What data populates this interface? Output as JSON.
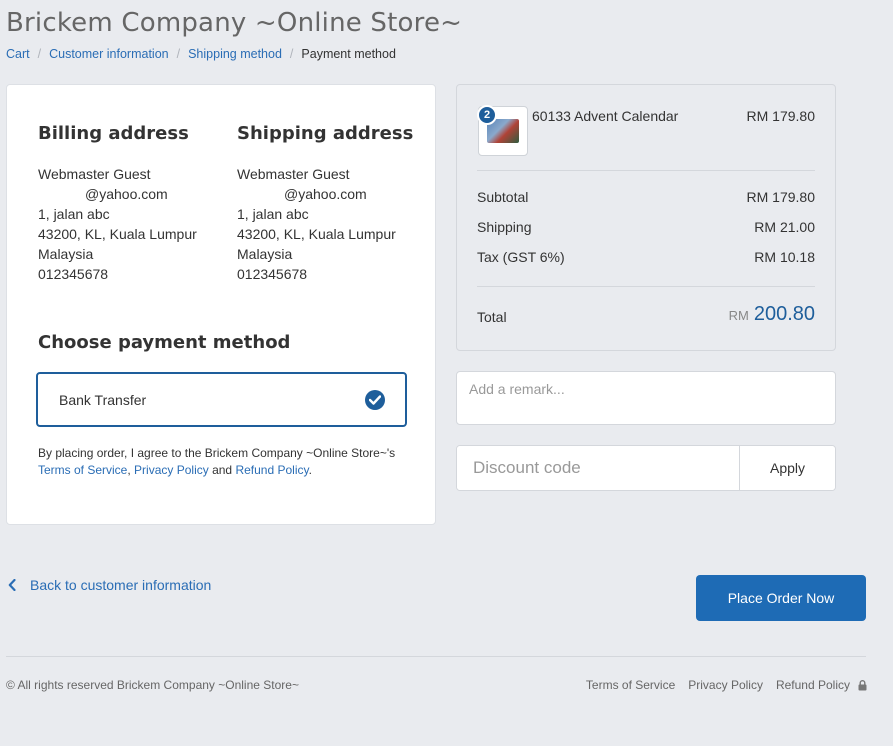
{
  "store": {
    "title": "Brickem Company ~Online Store~"
  },
  "breadcrumb": {
    "items": [
      "Cart",
      "Customer information",
      "Shipping method"
    ],
    "separator": "/",
    "current": "Payment method"
  },
  "billing": {
    "heading": "Billing address",
    "name": "Webmaster Guest",
    "email": "@yahoo.com",
    "street": "1, jalan abc",
    "city": "43200, KL, Kuala Lumpur",
    "country": "Malaysia",
    "phone": "012345678"
  },
  "shipping": {
    "heading": "Shipping address",
    "name": "Webmaster Guest",
    "email": "@yahoo.com",
    "street": "1, jalan abc",
    "city": "43200, KL, Kuala Lumpur",
    "country": "Malaysia",
    "phone": "012345678"
  },
  "payment": {
    "heading": "Choose payment method",
    "option_label": "Bank Transfer",
    "selected": true,
    "terms_prefix": "By placing order, I agree to the Brickem Company ~Online Store~'s",
    "terms_link": "Terms of Service",
    "comma": ",",
    "privacy_link": "Privacy Policy",
    "and": "and",
    "refund_link": "Refund Policy",
    "period": "."
  },
  "summary": {
    "product": {
      "name": "60133 Advent Calendar",
      "price": "RM 179.80",
      "quantity": "2"
    },
    "subtotal_label": "Subtotal",
    "subtotal_value": "RM 179.80",
    "shipping_label": "Shipping",
    "shipping_value": "RM 21.00",
    "tax_label": "Tax (GST 6%)",
    "tax_value": "RM 10.18",
    "total_label": "Total",
    "total_currency": "RM",
    "total_amount": "200.80"
  },
  "remark": {
    "placeholder": "Add a remark..."
  },
  "discount": {
    "placeholder": "Discount code",
    "apply_label": "Apply"
  },
  "nav": {
    "back_label": "Back to customer information",
    "place_order_label": "Place Order Now"
  },
  "footer": {
    "copyright": "© All rights reserved Brickem Company ~Online Store~",
    "links": [
      "Terms of Service",
      "Privacy Policy",
      "Refund Policy"
    ]
  },
  "colors": {
    "accent": "#1e6bb5",
    "link": "#2a6db5",
    "background": "#e9ebef",
    "selected_border": "#1e5e9b"
  },
  "icons": {
    "check": "check-circle-icon",
    "back": "chevron-left-icon",
    "lock": "lock-icon"
  }
}
